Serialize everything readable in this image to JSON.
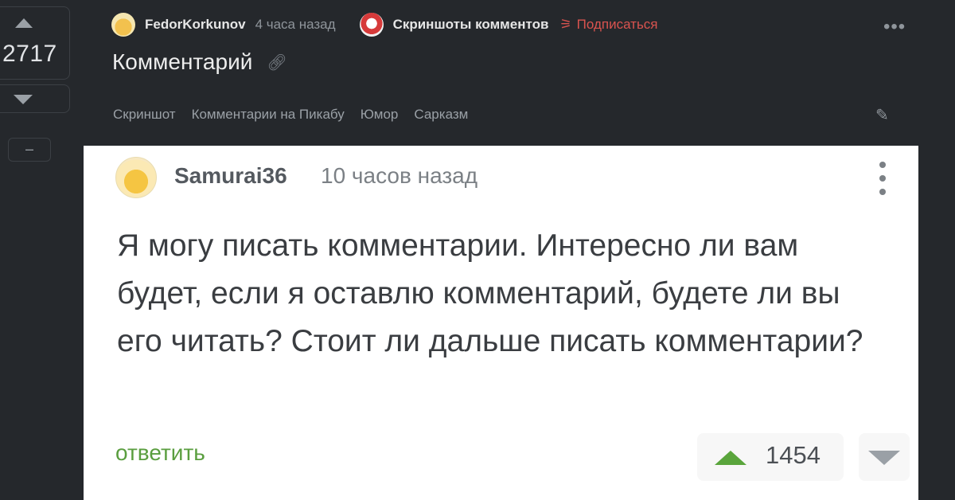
{
  "post": {
    "rating": "2717",
    "minus": "–",
    "author": "FedorKorkunov",
    "time": "4 часа назад",
    "community": "Скриншоты комментов",
    "subscribe": "Подписаться",
    "title": "Комментарий",
    "tags": [
      "Скриншот",
      "Комментарии на Пикабу",
      "Юмор",
      "Сарказм"
    ]
  },
  "comment": {
    "author": "Samurai36",
    "time": "10 часов назад",
    "text": "Я могу писать комментарии. Интересно ли вам будет, если я оставлю комментарий, будете ли вы его читать? Стоит ли дальше писать комментарии?",
    "reply": "ответить",
    "rating": "1454"
  },
  "icons": {
    "upvote": "triangle-up-icon",
    "downvote": "triangle-down-icon",
    "link": "link-icon",
    "edit": "pencil-icon",
    "more": "more-dots-icon",
    "subscribe": "rss-icon"
  },
  "colors": {
    "page_bg": "#25282c",
    "card_bg": "#ffffff",
    "subscribe": "#d9534f",
    "reply": "#5a9e3f",
    "upvote_green": "#5aa53c"
  }
}
